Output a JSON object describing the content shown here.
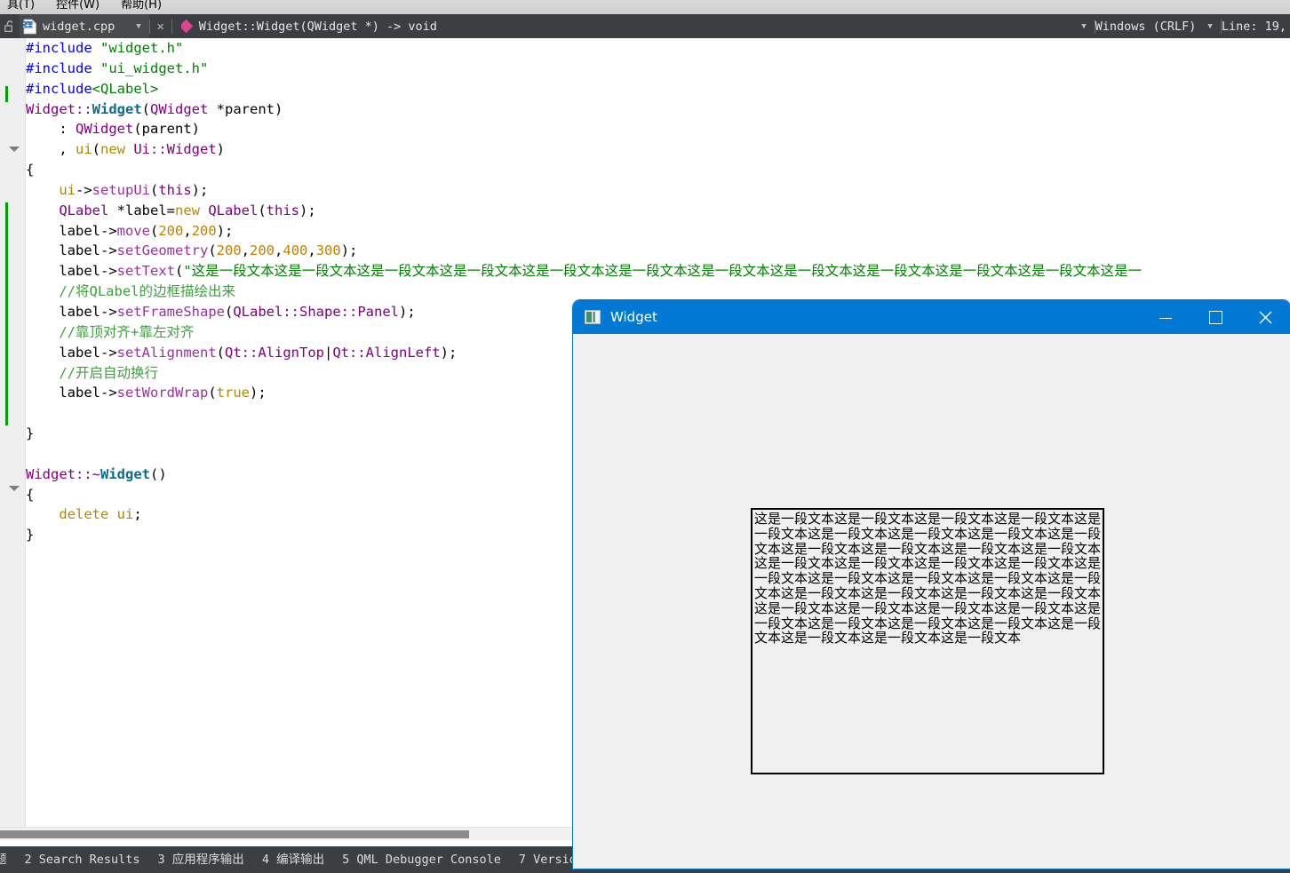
{
  "menubar": {
    "items": [
      "具(T)",
      "控件(W)",
      "帮助(H)"
    ]
  },
  "tabbar": {
    "lock_icon": "lock-open-icon",
    "file_icon": "cpp-file-icon",
    "filename": "widget.cpp",
    "dropdown_icon": "chevron-down-icon",
    "close_icon": "close-icon",
    "symbol_icon": "method-diamond-icon",
    "symbol": "Widget::Widget(QWidget *) -> void",
    "line_ending_dropdown_icon": "chevron-down-icon",
    "line_ending": "Windows (CRLF)",
    "position_dropdown_icon": "chevron-down-icon",
    "position": "Line: 19,"
  },
  "editor": {
    "lines": [
      {
        "indent": 0,
        "segments": [
          {
            "t": "#include ",
            "c": "k-pre"
          },
          {
            "t": "\"widget.h\"",
            "c": "k-str"
          }
        ]
      },
      {
        "indent": 0,
        "segments": [
          {
            "t": "#include ",
            "c": "k-pre"
          },
          {
            "t": "\"ui_widget.h\"",
            "c": "k-str"
          }
        ]
      },
      {
        "indent": 0,
        "segments": [
          {
            "t": "#include",
            "c": "k-pre"
          },
          {
            "t": "<QLabel>",
            "c": "k-str"
          }
        ]
      },
      {
        "indent": 0,
        "segments": [
          {
            "t": "Widget::",
            "c": "k-type"
          },
          {
            "t": "Widget",
            "c": "k-fn"
          },
          {
            "t": "(",
            "c": "k-op"
          },
          {
            "t": "QWidget",
            "c": "k-type"
          },
          {
            "t": " *parent",
            "c": "k-pln"
          },
          {
            "t": ")",
            "c": "k-op"
          }
        ]
      },
      {
        "indent": 1,
        "segments": [
          {
            "t": ": ",
            "c": "k-op"
          },
          {
            "t": "QWidget",
            "c": "k-type"
          },
          {
            "t": "(parent)",
            "c": "k-pln"
          }
        ]
      },
      {
        "indent": 1,
        "segments": [
          {
            "t": ", ",
            "c": "k-op"
          },
          {
            "t": "ui",
            "c": "k-var"
          },
          {
            "t": "(",
            "c": "k-op"
          },
          {
            "t": "new ",
            "c": "k-kw"
          },
          {
            "t": "Ui::Widget",
            "c": "k-type"
          },
          {
            "t": ")",
            "c": "k-op"
          }
        ]
      },
      {
        "indent": 0,
        "segments": [
          {
            "t": "{",
            "c": "k-op"
          }
        ]
      },
      {
        "indent": 1,
        "segments": [
          {
            "t": "ui",
            "c": "k-var"
          },
          {
            "t": "->",
            "c": "k-op"
          },
          {
            "t": "setupUi",
            "c": "k-mth"
          },
          {
            "t": "(",
            "c": "k-op"
          },
          {
            "t": "this",
            "c": "k-type"
          },
          {
            "t": ");",
            "c": "k-op"
          }
        ]
      },
      {
        "indent": 1,
        "segments": [
          {
            "t": "QLabel",
            "c": "k-type"
          },
          {
            "t": " *label=",
            "c": "k-pln"
          },
          {
            "t": "new ",
            "c": "k-kw"
          },
          {
            "t": "QLabel",
            "c": "k-type"
          },
          {
            "t": "(",
            "c": "k-op"
          },
          {
            "t": "this",
            "c": "k-type"
          },
          {
            "t": ");",
            "c": "k-op"
          }
        ]
      },
      {
        "indent": 1,
        "segments": [
          {
            "t": "label",
            "c": "k-pln"
          },
          {
            "t": "->",
            "c": "k-op"
          },
          {
            "t": "move",
            "c": "k-mth"
          },
          {
            "t": "(",
            "c": "k-op"
          },
          {
            "t": "200",
            "c": "k-num"
          },
          {
            "t": ",",
            "c": "k-op"
          },
          {
            "t": "200",
            "c": "k-num"
          },
          {
            "t": ");",
            "c": "k-op"
          }
        ]
      },
      {
        "indent": 1,
        "segments": [
          {
            "t": "label",
            "c": "k-pln"
          },
          {
            "t": "->",
            "c": "k-op"
          },
          {
            "t": "setGeometry",
            "c": "k-mth"
          },
          {
            "t": "(",
            "c": "k-op"
          },
          {
            "t": "200",
            "c": "k-num"
          },
          {
            "t": ",",
            "c": "k-op"
          },
          {
            "t": "200",
            "c": "k-num"
          },
          {
            "t": ",",
            "c": "k-op"
          },
          {
            "t": "400",
            "c": "k-num"
          },
          {
            "t": ",",
            "c": "k-op"
          },
          {
            "t": "300",
            "c": "k-num"
          },
          {
            "t": ");",
            "c": "k-op"
          }
        ]
      },
      {
        "indent": 1,
        "segments": [
          {
            "t": "label",
            "c": "k-pln"
          },
          {
            "t": "->",
            "c": "k-op"
          },
          {
            "t": "setText",
            "c": "k-mth"
          },
          {
            "t": "(",
            "c": "k-op"
          },
          {
            "t": "\"这是一段文本这是一段文本这是一段文本这是一段文本这是一段文本这是一段文本这是一段文本这是一段文本这是一段文本这是一段文本这是一段文本这是一",
            "c": "k-str"
          }
        ]
      },
      {
        "indent": 1,
        "segments": [
          {
            "t": "//将QLabel的边框描绘出来",
            "c": "k-cmt"
          }
        ]
      },
      {
        "indent": 1,
        "segments": [
          {
            "t": "label",
            "c": "k-pln"
          },
          {
            "t": "->",
            "c": "k-op"
          },
          {
            "t": "setFrameShape",
            "c": "k-mth"
          },
          {
            "t": "(",
            "c": "k-op"
          },
          {
            "t": "QLabel::Shape::Panel",
            "c": "k-type"
          },
          {
            "t": ");",
            "c": "k-op"
          }
        ]
      },
      {
        "indent": 1,
        "segments": [
          {
            "t": "//靠顶对齐+靠左对齐",
            "c": "k-cmt"
          }
        ]
      },
      {
        "indent": 1,
        "segments": [
          {
            "t": "label",
            "c": "k-pln"
          },
          {
            "t": "->",
            "c": "k-op"
          },
          {
            "t": "setAlignment",
            "c": "k-mth"
          },
          {
            "t": "(",
            "c": "k-op"
          },
          {
            "t": "Qt::AlignTop",
            "c": "k-type"
          },
          {
            "t": "|",
            "c": "k-op"
          },
          {
            "t": "Qt::AlignLeft",
            "c": "k-type"
          },
          {
            "t": ");",
            "c": "k-op"
          }
        ]
      },
      {
        "indent": 1,
        "segments": [
          {
            "t": "//开启自动换行",
            "c": "k-cmt"
          }
        ]
      },
      {
        "indent": 1,
        "segments": [
          {
            "t": "label",
            "c": "k-pln"
          },
          {
            "t": "->",
            "c": "k-op"
          },
          {
            "t": "setWordWrap",
            "c": "k-mth"
          },
          {
            "t": "(",
            "c": "k-op"
          },
          {
            "t": "true",
            "c": "k-kw"
          },
          {
            "t": ");",
            "c": "k-op"
          }
        ]
      },
      {
        "indent": 0,
        "segments": []
      },
      {
        "indent": 0,
        "segments": [
          {
            "t": "}",
            "c": "k-op"
          }
        ]
      },
      {
        "indent": 0,
        "segments": []
      },
      {
        "indent": 0,
        "segments": [
          {
            "t": "Widget::~",
            "c": "k-type"
          },
          {
            "t": "Widget",
            "c": "k-fn"
          },
          {
            "t": "()",
            "c": "k-op"
          }
        ]
      },
      {
        "indent": 0,
        "segments": [
          {
            "t": "{",
            "c": "k-op"
          }
        ]
      },
      {
        "indent": 1,
        "segments": [
          {
            "t": "delete ",
            "c": "k-kw"
          },
          {
            "t": "ui",
            "c": "k-var"
          },
          {
            "t": ";",
            "c": "k-op"
          }
        ]
      },
      {
        "indent": 0,
        "segments": [
          {
            "t": "}",
            "c": "k-op"
          }
        ]
      }
    ]
  },
  "bottombar": {
    "items": [
      "题",
      "2 Search Results",
      "3 应用程序输出",
      "4 编译输出",
      "5 QML Debugger Console",
      "7 Versio"
    ]
  },
  "qtwindow": {
    "app_icon": "qt-app-icon",
    "title": "Widget",
    "minimize_icon": "minimize-icon",
    "maximize_icon": "maximize-icon",
    "close_icon": "close-icon",
    "label_text": "这是一段文本这是一段文本这是一段文本这是一段文本这是一段文本这是一段文本这是一段文本这是一段文本这是一段文本这是一段文本这是一段文本这是一段文本这是一段文本这是一段文本这是一段文本这是一段文本这是一段文本这是一段文本这是一段文本这是一段文本这是一段文本这是一段文本这是一段文本这是一段文本这是一段文本这是一段文本这是一段文本这是一段文本这是一段文本这是一段文本这是一段文本这是一段文本这是一段文本这是一段文本这是一段文本这是一段文本这是一段文本这是一段文本"
  },
  "colors": {
    "accent_blue": "#0078d4",
    "dark_chrome": "#3c3f41",
    "change_bar_green": "#00a000",
    "symbol_pink": "#e0448c"
  }
}
